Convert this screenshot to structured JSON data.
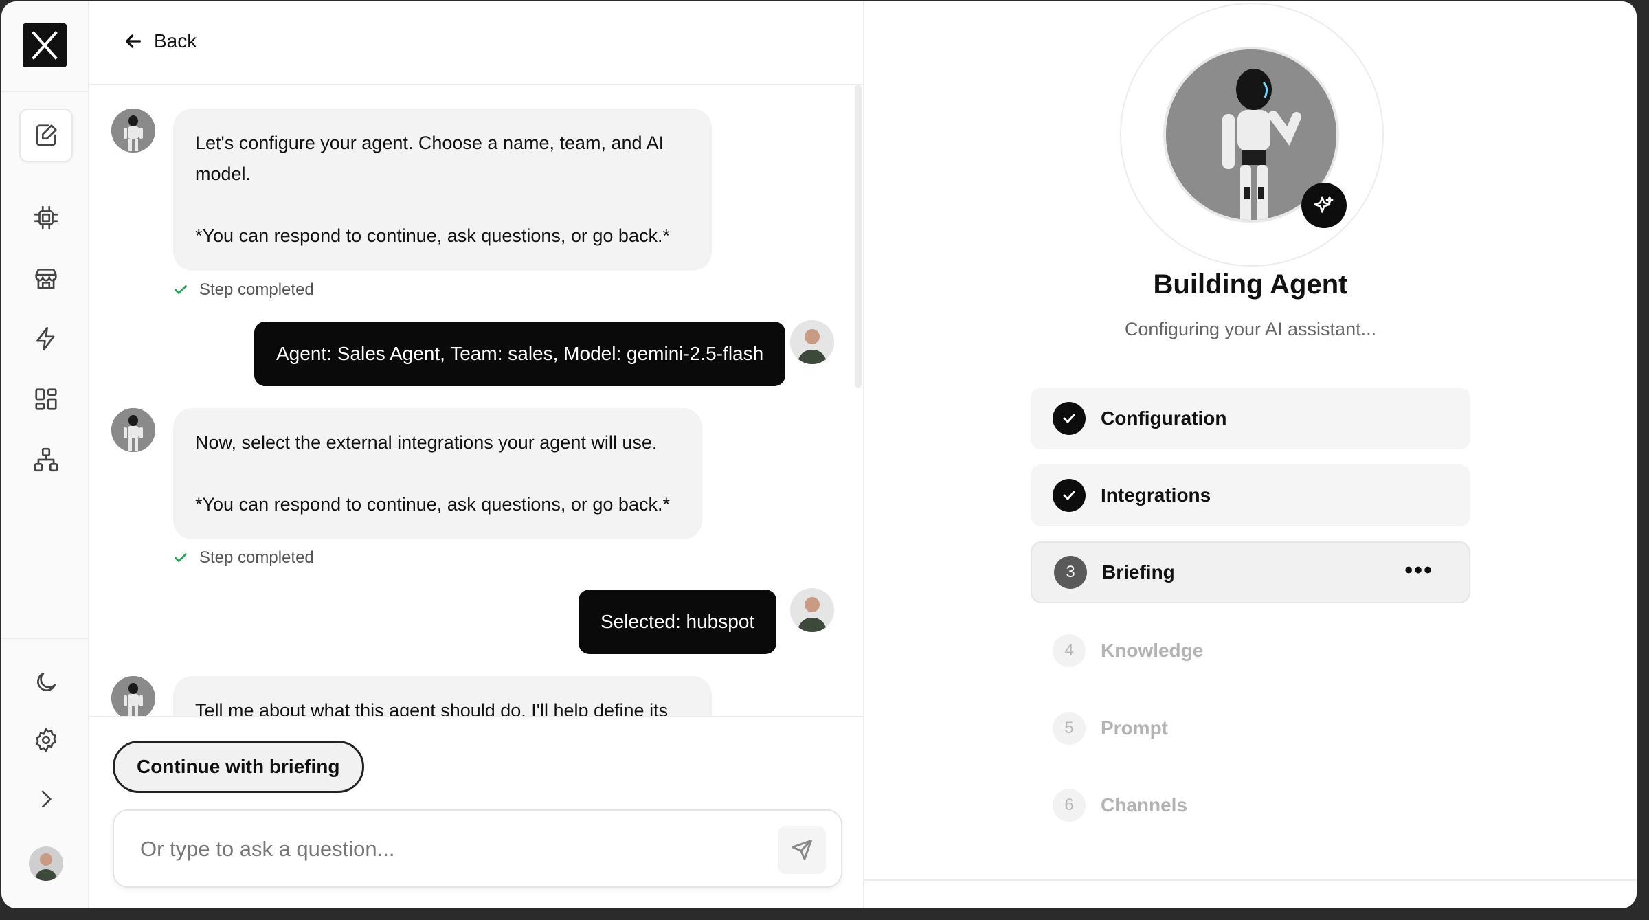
{
  "header": {
    "back_label": "Back"
  },
  "rail": {
    "items": [
      "edit-icon",
      "chip-icon",
      "store-icon",
      "lightning-icon",
      "grid-icon",
      "hierarchy-icon"
    ],
    "bottom_items": [
      "moon-icon",
      "gear-icon",
      "chevron-right-icon"
    ]
  },
  "chat": {
    "messages": [
      {
        "role": "bot",
        "lines": [
          "Let's configure your agent. Choose a name, team, and AI",
          "model."
        ],
        "note": "*You can respond to continue, ask questions, or go back.*"
      },
      {
        "role": "status",
        "text": "Step completed"
      },
      {
        "role": "user",
        "text": "Agent: Sales Agent, Team: sales, Model: gemini-2.5-flash"
      },
      {
        "role": "bot",
        "lines": [
          "Now, select the external integrations your agent will use."
        ],
        "note": "*You can respond to continue, ask questions, or go back.*"
      },
      {
        "role": "status",
        "text": "Step completed"
      },
      {
        "role": "user",
        "text": "Selected: hubspot"
      },
      {
        "role": "bot",
        "lines": [
          "Tell me about what this agent should do. I'll help define its"
        ]
      }
    ],
    "cta_label": "Continue with briefing",
    "input_placeholder": "Or type to ask a question..."
  },
  "panel": {
    "title": "Building Agent",
    "subtitle": "Configuring your AI assistant...",
    "steps": [
      {
        "number": "1",
        "label": "Configuration",
        "state": "done"
      },
      {
        "number": "2",
        "label": "Integrations",
        "state": "done"
      },
      {
        "number": "3",
        "label": "Briefing",
        "state": "current",
        "menu": "•••"
      },
      {
        "number": "4",
        "label": "Knowledge",
        "state": "pending"
      },
      {
        "number": "5",
        "label": "Prompt",
        "state": "pending"
      },
      {
        "number": "6",
        "label": "Channels",
        "state": "pending"
      }
    ]
  },
  "colors": {
    "primary": "#0a0a0a",
    "success": "#22a554",
    "muted": "#b3b3b3"
  }
}
